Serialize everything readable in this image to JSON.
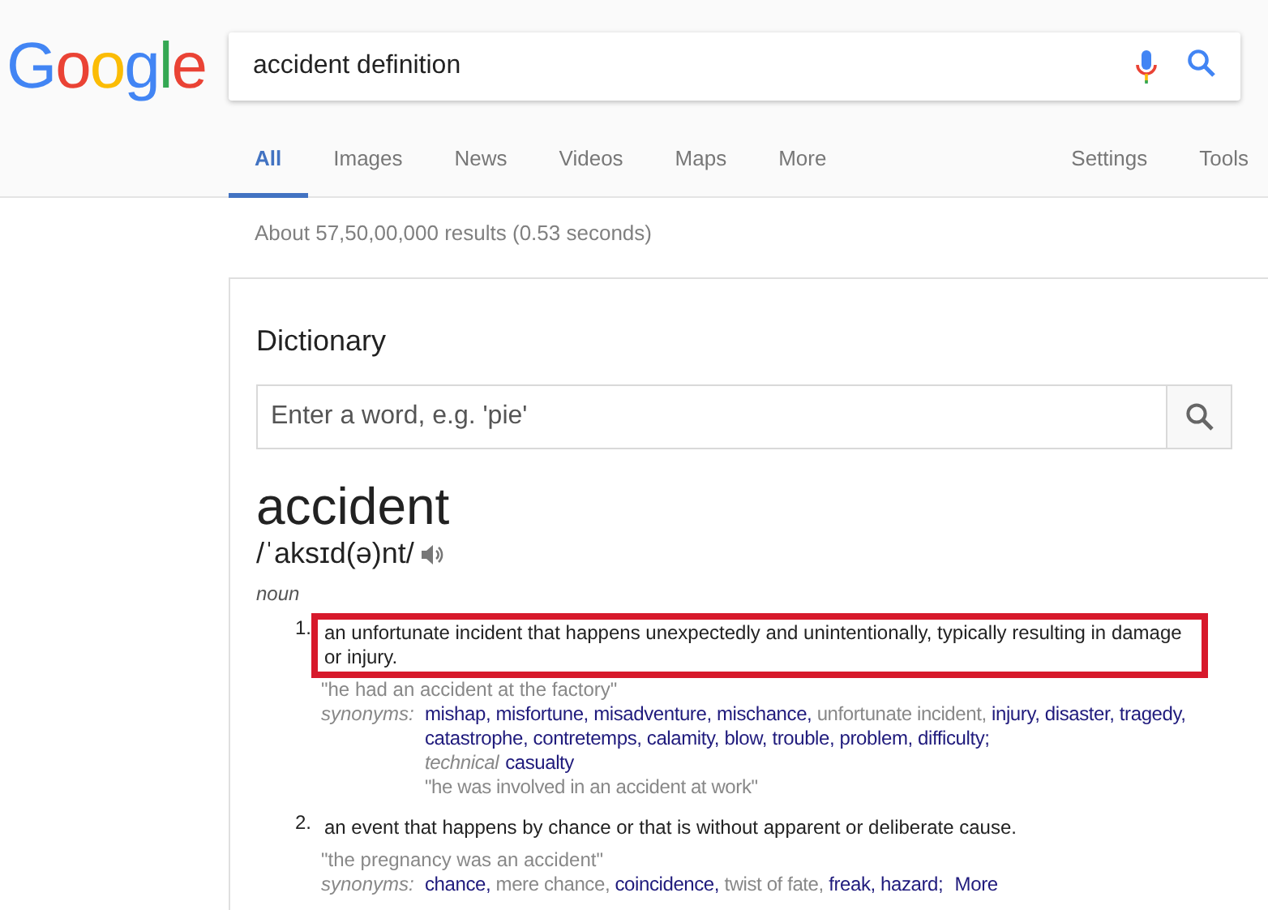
{
  "logo": {
    "letters": [
      {
        "text": "G",
        "color": "#4285f4"
      },
      {
        "text": "o",
        "color": "#ea4335"
      },
      {
        "text": "o",
        "color": "#fbbc05"
      },
      {
        "text": "g",
        "color": "#4285f4"
      },
      {
        "text": "l",
        "color": "#34a853"
      },
      {
        "text": "e",
        "color": "#ea4335"
      }
    ]
  },
  "search": {
    "value": "accident definition"
  },
  "tabs": [
    {
      "label": "All",
      "selected": true
    },
    {
      "label": "Images",
      "selected": false
    },
    {
      "label": "News",
      "selected": false
    },
    {
      "label": "Videos",
      "selected": false
    },
    {
      "label": "Maps",
      "selected": false
    },
    {
      "label": "More",
      "selected": false
    }
  ],
  "tools": [
    "Settings",
    "Tools"
  ],
  "result_stats": "About 57,50,00,000 results (0.53 seconds)",
  "dictionary": {
    "title": "Dictionary",
    "search": {
      "placeholder": "Enter a word, e.g. 'pie'"
    },
    "word": "accident",
    "phonetic": "/ˈaksɪd(ə)nt/",
    "part_of_speech": "noun",
    "definitions": [
      {
        "number": "1.",
        "text": "an unfortunate incident that happens unexpectedly and unintentionally, typically resulting in damage or injury.",
        "highlighted": true,
        "example": "\"he had an accident at the factory\"",
        "synonyms_label": "synonyms:",
        "synonym_groups": [
          {
            "items": [
              {
                "text": "mishap,",
                "linked": true
              },
              {
                "text": "misfortune,",
                "linked": true
              },
              {
                "text": "misadventure,",
                "linked": true
              },
              {
                "text": "mischance,",
                "linked": true
              },
              {
                "text": "unfortunate incident,",
                "linked": false
              },
              {
                "text": "injury,",
                "linked": true
              },
              {
                "text": "disaster,",
                "linked": true
              },
              {
                "text": "tragedy,",
                "linked": true
              },
              {
                "text": "catastrophe,",
                "linked": true
              },
              {
                "text": "contretemps,",
                "linked": true
              },
              {
                "text": "calamity,",
                "linked": true
              },
              {
                "text": "blow,",
                "linked": true
              },
              {
                "text": "trouble,",
                "linked": true
              },
              {
                "text": "problem,",
                "linked": true
              },
              {
                "text": "difficulty;",
                "linked": true
              }
            ]
          },
          {
            "label": "technical",
            "items": [
              {
                "text": "casualty",
                "linked": true
              }
            ],
            "example": "\"he was involved in an accident at work\""
          }
        ]
      },
      {
        "number": "2.",
        "text": "an event that happens by chance or that is without apparent or deliberate cause.",
        "highlighted": false,
        "example": "\"the pregnancy was an accident\"",
        "synonyms_label": "synonyms:",
        "synonym_groups": [
          {
            "items": [
              {
                "text": "chance,",
                "linked": true
              },
              {
                "text": "mere chance,",
                "linked": false
              },
              {
                "text": "coincidence,",
                "linked": true
              },
              {
                "text": "twist of fate,",
                "linked": false
              },
              {
                "text": "freak,",
                "linked": true
              },
              {
                "text": "hazard;",
                "linked": true
              }
            ],
            "more": "More"
          }
        ]
      }
    ]
  }
}
